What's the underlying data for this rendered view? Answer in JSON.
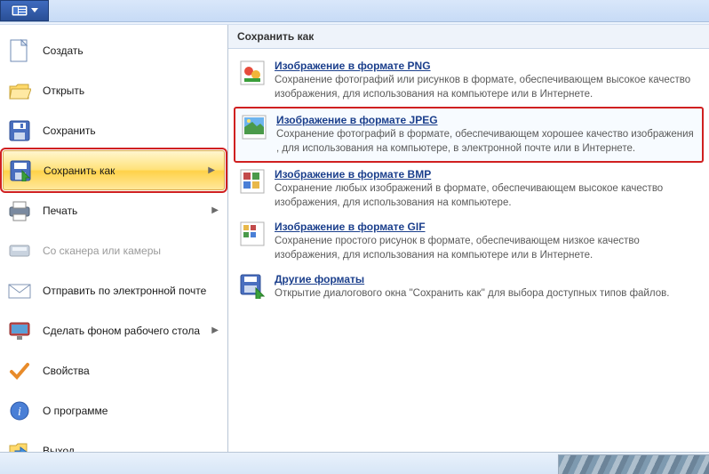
{
  "titlebar": {},
  "leftMenu": {
    "items": [
      {
        "label": "Создать"
      },
      {
        "label": "Открыть"
      },
      {
        "label": "Сохранить"
      },
      {
        "label": "Сохранить как"
      },
      {
        "label": "Печать"
      },
      {
        "label": "Со сканера или камеры"
      },
      {
        "label": "Отправить по электронной почте"
      },
      {
        "label": "Сделать фоном рабочего стола"
      },
      {
        "label": "Свойства"
      },
      {
        "label": "О программе"
      },
      {
        "label": "Выход"
      }
    ]
  },
  "rightPanel": {
    "header": "Сохранить как",
    "formats": [
      {
        "title": "Изображение в формате PNG",
        "desc": "Сохранение фотографий или рисунков в формате, обеспечивающем высокое качество изображения, для использования на компьютере или в Интернете."
      },
      {
        "title": "Изображение в формате JPEG",
        "desc": "Сохранение фотографий в формате, обеспечивающем хорошее качество изображения , для использования на компьютере, в электронной почте или в Интернете."
      },
      {
        "title": "Изображение в формате BMP",
        "desc": "Сохранение любых изображений в формате, обеспечивающем высокое качество изображения, для использования на компьютере."
      },
      {
        "title": "Изображение в формате GIF",
        "desc": "Сохранение простого рисунок в формате, обеспечивающем низкое качество изображения, для использования на компьютере или в Интернете."
      },
      {
        "title": "Другие форматы",
        "desc": "Открытие диалогового окна \"Сохранить как\" для выбора доступных типов файлов."
      }
    ]
  }
}
